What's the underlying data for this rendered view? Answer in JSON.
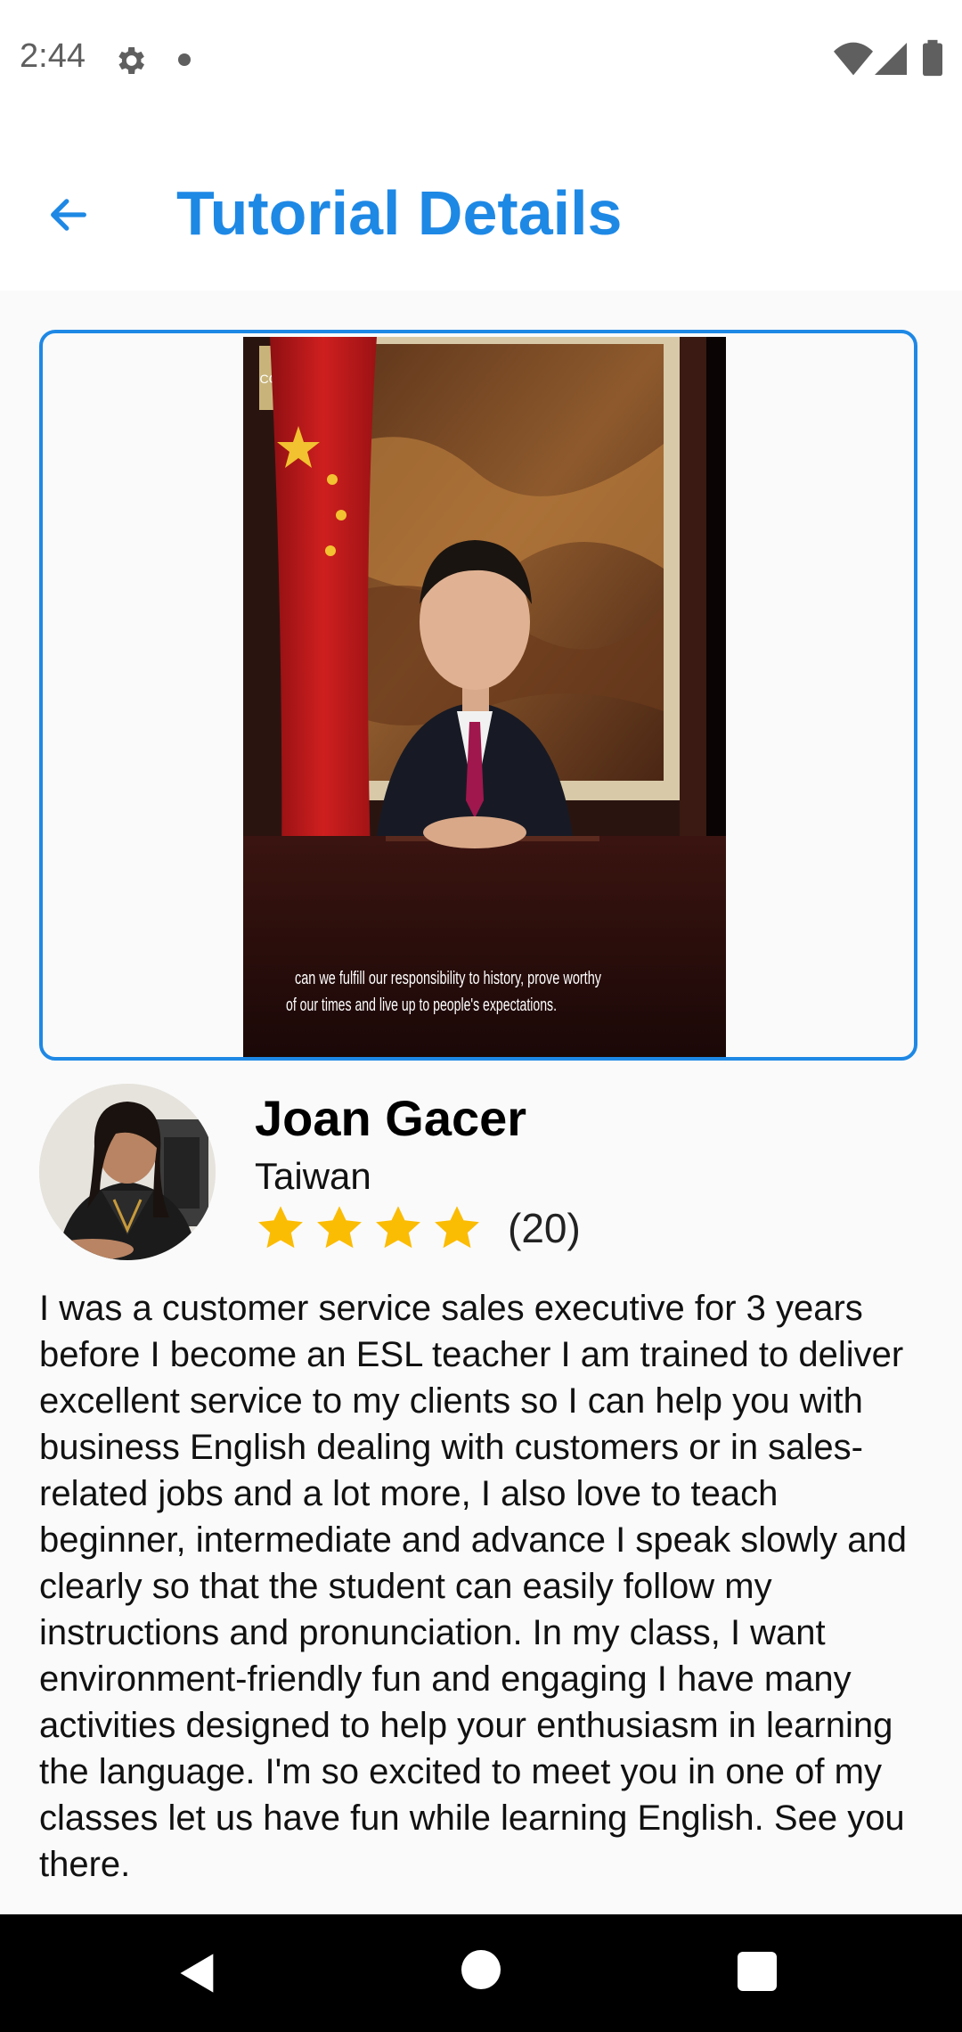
{
  "status_bar": {
    "time": "2:44",
    "icons": [
      "gear-icon",
      "notification-dot-icon",
      "wifi-icon",
      "signal-icon",
      "battery-icon"
    ]
  },
  "app_bar": {
    "back_icon": "arrow-left-icon",
    "title": "Tutorial Details"
  },
  "video": {
    "watermark": "CCTN",
    "subtitle_line1": "can we fulfill our responsibility to history, prove worthy",
    "subtitle_line2": "of our times and live up to people's expectations."
  },
  "tutor": {
    "name": "Joan Gacer",
    "country": "Taiwan",
    "rating_stars": 4,
    "rating_count": "(20)",
    "description": "I was a customer service sales executive for 3 years before I become an ESL teacher I am trained to deliver excellent service to my clients so I can help you with business English dealing with customers or in sales-related jobs and a lot more, I also love to teach beginner, intermediate and advance I speak slowly and clearly so that the student can easily follow my instructions and pronunciation. In my class, I want environment-friendly fun and engaging I have many activities designed to help your enthusiasm in learning the language. I'm so excited to meet you in one of my classes let us have fun while learning English. See you there."
  },
  "colors": {
    "accent": "#1e88e5",
    "star": "#fbbc04",
    "nav_bar": "#000000"
  },
  "nav_bar": {
    "icons": [
      "nav-back-icon",
      "nav-home-icon",
      "nav-recents-icon"
    ]
  }
}
